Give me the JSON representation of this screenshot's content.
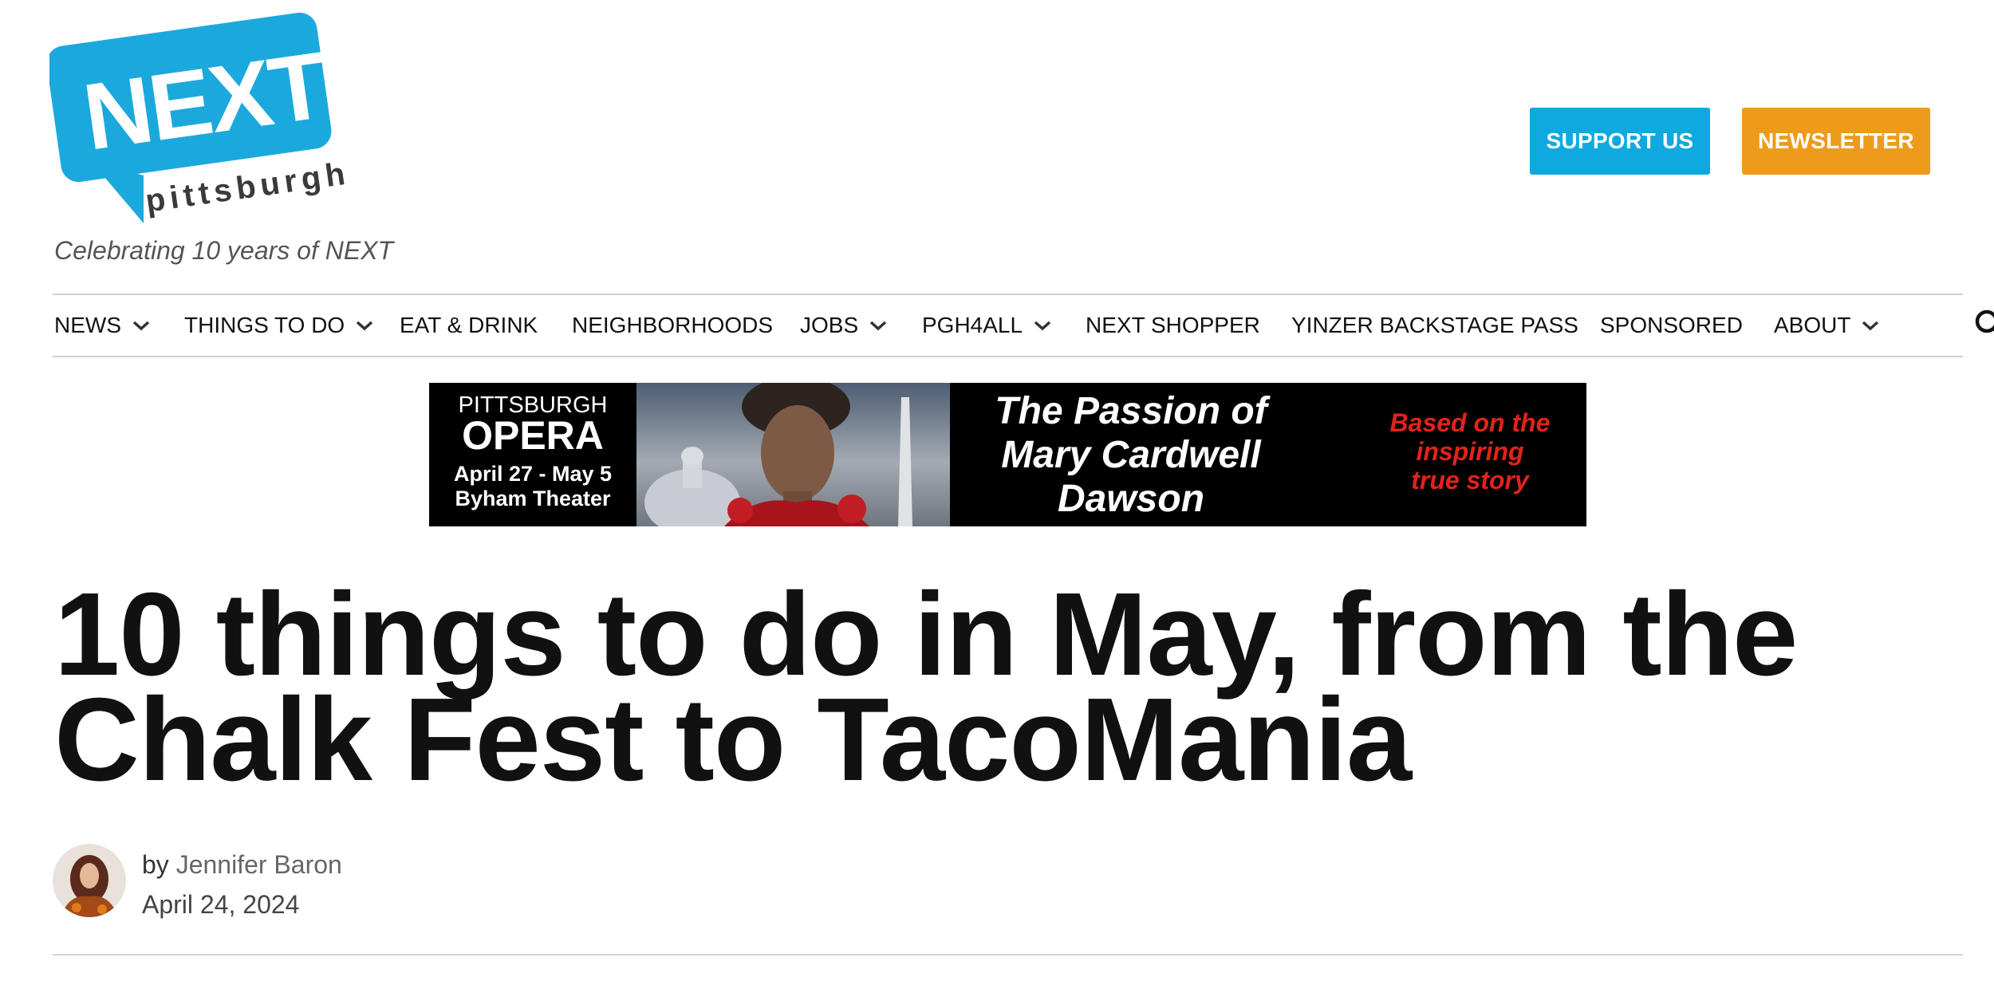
{
  "header": {
    "logo": {
      "word": "NEXT",
      "sub": "pittsburgh",
      "color": "#1ba9dd"
    },
    "tagline": "Celebrating 10 years of NEXT",
    "buttons": {
      "support": {
        "label": "SUPPORT US",
        "color": "#0fa9df"
      },
      "newsletter": {
        "label": "NEWSLETTER",
        "color": "#ee9b1c"
      }
    }
  },
  "nav": {
    "items": [
      {
        "label": "NEWS",
        "dropdown": true
      },
      {
        "label": "THINGS TO DO",
        "dropdown": true
      },
      {
        "label": "EAT & DRINK",
        "dropdown": false
      },
      {
        "label": "NEIGHBORHOODS",
        "dropdown": false
      },
      {
        "label": "JOBS",
        "dropdown": true
      },
      {
        "label": "PGH4ALL",
        "dropdown": true
      },
      {
        "label": "NEXT SHOPPER",
        "dropdown": false
      },
      {
        "label": "YINZER BACKSTAGE PASS",
        "dropdown": false
      },
      {
        "label": "SPONSORED",
        "dropdown": false
      },
      {
        "label": "ABOUT",
        "dropdown": true
      }
    ],
    "search_icon": "search-icon"
  },
  "ad": {
    "brand_top": "PITTSBURGH",
    "brand_main": "OPERA",
    "dates": "April 27 - May 5",
    "venue": "Byham Theater",
    "title_lines": [
      "The Passion of",
      "Mary Cardwell",
      "Dawson"
    ],
    "tagline_lines": [
      "Based on the",
      "inspiring",
      "true story"
    ],
    "tagline_color": "#e2231a"
  },
  "article": {
    "headline_lines": [
      "10 things to do in May, from the",
      "Chalk Fest to TacoMania"
    ],
    "byline_prefix": "by",
    "author": "Jennifer Baron",
    "date": "April 24, 2024"
  }
}
